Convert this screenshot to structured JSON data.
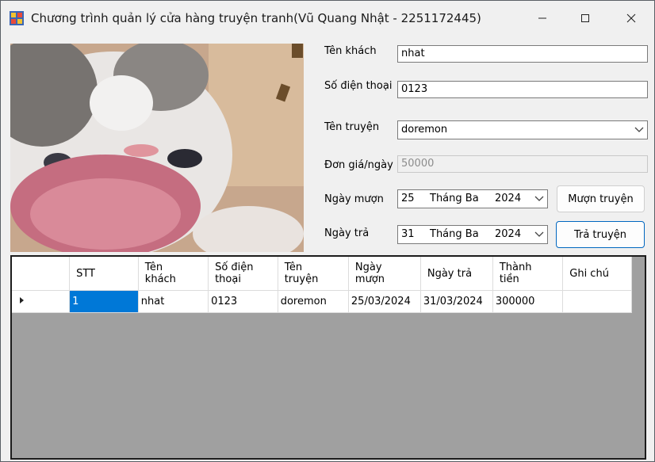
{
  "window": {
    "title": "Chương trình quản lý cửa hàng truyện tranh(Vũ Quang Nhật - 2251172445)",
    "icons": [
      "app-icon",
      "minimize-icon",
      "maximize-icon",
      "close-icon"
    ]
  },
  "form": {
    "customer_label": "Tên khách",
    "customer_value": "nhat",
    "phone_label": "Số điện thoại",
    "phone_value": "0123",
    "comic_label": "Tên truyện",
    "comic_value": "doremon",
    "price_label": "Đơn giá/ngày",
    "price_value": "50000",
    "borrow_date_label": "Ngày mượn",
    "borrow_date": {
      "day": "25",
      "month": "Tháng Ba",
      "year": "2024"
    },
    "return_date_label": "Ngày trả",
    "return_date": {
      "day": "31",
      "month": "Tháng Ba",
      "year": "2024"
    },
    "borrow_button": "Mượn truyện",
    "return_button": "Trả truyện"
  },
  "grid": {
    "columns": [
      {
        "line1": "STT",
        "line2": ""
      },
      {
        "line1": "Tên",
        "line2": "khách"
      },
      {
        "line1": "Số điện",
        "line2": "thoại"
      },
      {
        "line1": "Tên",
        "line2": "truyện"
      },
      {
        "line1": "Ngày",
        "line2": "mượn"
      },
      {
        "line1": "Ngày trả",
        "line2": ""
      },
      {
        "line1": "Thành",
        "line2": "tiền"
      },
      {
        "line1": "Ghi chú",
        "line2": ""
      }
    ],
    "rows": [
      [
        "1",
        "nhat",
        "0123",
        "doremon",
        "25/03/2024",
        "31/03/2024",
        "300000",
        ""
      ]
    ]
  }
}
